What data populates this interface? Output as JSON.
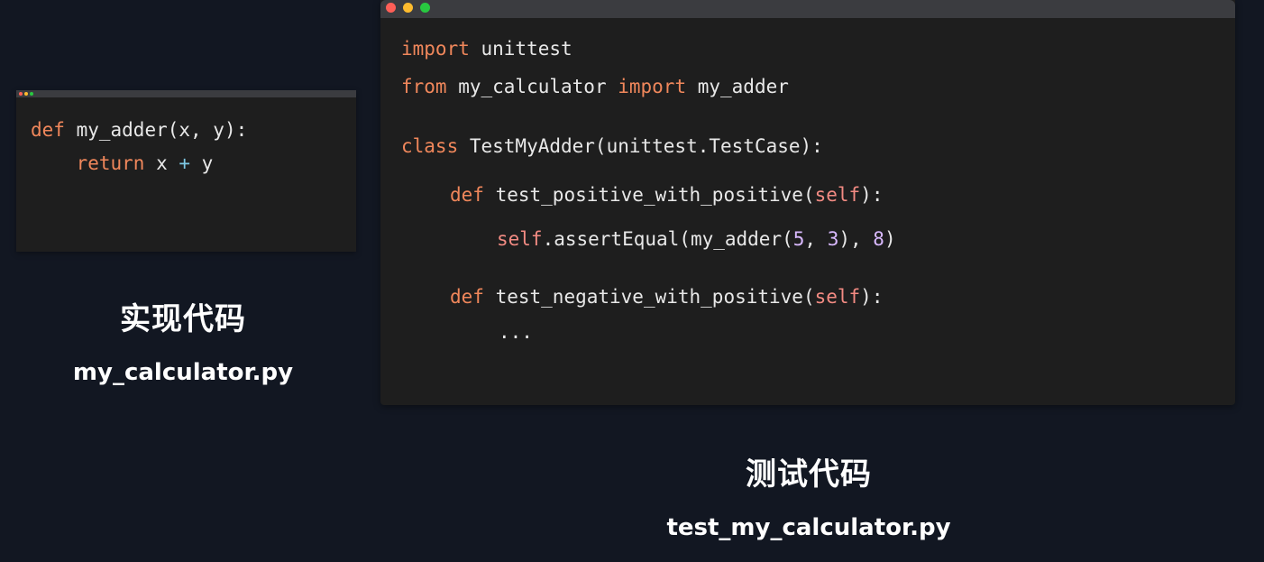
{
  "colors": {
    "background": "#121722",
    "editor_bg": "#1e1e1e",
    "titlebar": "#3b3c40",
    "keyword": "#f0875b",
    "self": "#f38b83",
    "number": "#d9b9ff",
    "text": "#e8e8e8"
  },
  "impl_window": {
    "line1": {
      "kw": "def",
      "rest": " my_adder(x, y):"
    },
    "line2": {
      "indent": "    ",
      "kw": "return",
      "a": " x ",
      "op": "+",
      "b": " y"
    }
  },
  "impl_caption": {
    "title": "实现代码",
    "filename": "my_calculator.py"
  },
  "test_window": {
    "line1": {
      "kw": "import",
      "rest": " unittest"
    },
    "line2": {
      "kw1": "from",
      "mid": " my_calculator ",
      "kw2": "import",
      "rest": " my_adder"
    },
    "line3": {
      "kw": "class",
      "rest": " TestMyAdder(unittest.TestCase):"
    },
    "line4": {
      "kw": "def",
      "mid": " test_positive_with_positive(",
      "self": "self",
      "end": "):"
    },
    "line5": {
      "self": "self",
      "a": ".assertEqual(my_adder(",
      "n1": "5",
      "comma": ", ",
      "n2": "3",
      "b": "), ",
      "n3": "8",
      "end": ")"
    },
    "line6": {
      "kw": "def",
      "mid": " test_negative_with_positive(",
      "self": "self",
      "end": "):"
    },
    "line7": {
      "text": "..."
    }
  },
  "test_caption": {
    "title": "测试代码",
    "filename": "test_my_calculator.py"
  }
}
